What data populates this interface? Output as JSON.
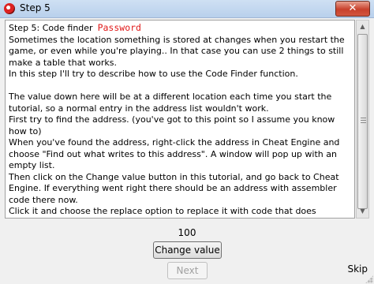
{
  "window": {
    "title": "Step 5",
    "close_label": "✕"
  },
  "step": {
    "heading": "Step 5: Code finder",
    "password": "Password",
    "paragraphs": [
      "Sometimes the location something is stored at changes when you restart the game, or even while you're playing.. In that case you can use 2 things to still make a table that works.",
      "In this step I'll try to describe how to use the Code Finder function.",
      "",
      "The value down here will be at a different location each time you start the tutorial, so a normal entry in the address list wouldn't work.",
      "First try to find the address. (you've got to this point so I assume you know how to)",
      "When you've found the address, right-click the address in Cheat Engine and choose \"Find out what writes to this address\". A window will pop up with an empty list.",
      "Then click on the Change value button in this tutorial, and go back to Cheat Engine. If everything went right there should be an address with assembler code there now.",
      "Click it and choose the replace option to replace it with code that does nothing. That will also add the code address to the code list in the advanced options window. (Which gets saved if you save your table)"
    ]
  },
  "value": "100",
  "buttons": {
    "change_value": "Change value",
    "next": "Next",
    "skip": "Skip"
  },
  "icons": {
    "app": "cheat-engine-icon",
    "close": "close-icon",
    "scroll_up": "scroll-up-arrow-icon",
    "scroll_down": "scroll-down-arrow-icon"
  }
}
